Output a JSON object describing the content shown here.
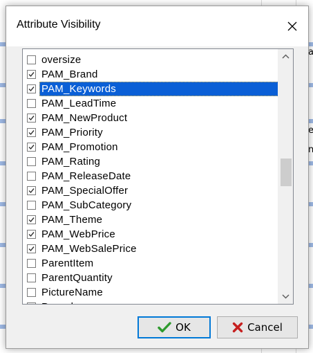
{
  "dialog": {
    "title": "Attribute Visibility",
    "close_icon": "close-icon"
  },
  "items": [
    {
      "label": "oversize",
      "checked": false,
      "selected": false
    },
    {
      "label": "PAM_Brand",
      "checked": true,
      "selected": false
    },
    {
      "label": "PAM_Keywords",
      "checked": true,
      "selected": true
    },
    {
      "label": "PAM_LeadTime",
      "checked": false,
      "selected": false
    },
    {
      "label": "PAM_NewProduct",
      "checked": true,
      "selected": false
    },
    {
      "label": "PAM_Priority",
      "checked": true,
      "selected": false
    },
    {
      "label": "PAM_Promotion",
      "checked": true,
      "selected": false
    },
    {
      "label": "PAM_Rating",
      "checked": false,
      "selected": false
    },
    {
      "label": "PAM_ReleaseDate",
      "checked": false,
      "selected": false
    },
    {
      "label": "PAM_SpecialOffer",
      "checked": true,
      "selected": false
    },
    {
      "label": "PAM_SubCategory",
      "checked": false,
      "selected": false
    },
    {
      "label": "PAM_Theme",
      "checked": true,
      "selected": false
    },
    {
      "label": "PAM_WebPrice",
      "checked": true,
      "selected": false
    },
    {
      "label": "PAM_WebSalePrice",
      "checked": true,
      "selected": false
    },
    {
      "label": "ParentItem",
      "checked": false,
      "selected": false
    },
    {
      "label": "ParentQuantity",
      "checked": false,
      "selected": false
    },
    {
      "label": "PictureName",
      "checked": false,
      "selected": false
    },
    {
      "label": "Preorder",
      "checked": false,
      "selected": false
    }
  ],
  "scroll": {
    "position_fraction": 0.48
  },
  "buttons": {
    "ok_label": "OK",
    "ok_icon": "checkmark-icon",
    "cancel_label": "Cancel",
    "cancel_icon": "x-icon"
  },
  "colors": {
    "selection": "#0a5fd6",
    "ok_icon": "#2e9a2e",
    "cancel_icon": "#c62020",
    "focus_border": "#0078d7"
  },
  "background": {
    "fragments": [
      "a",
      "e",
      "n"
    ]
  }
}
